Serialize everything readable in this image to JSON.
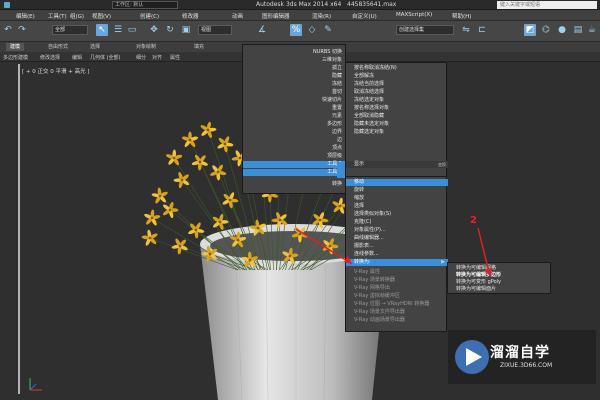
{
  "titlebar": {
    "workspace_label": "工作区: 默认",
    "app_title": "Autodesk 3ds Max  2014 x64",
    "file_name": "445835641.max",
    "search_placeholder": "键入关键字或短语"
  },
  "menubar": [
    "编辑(E)",
    "工具(T)",
    "组(G)",
    "视图(V)",
    "创建(C)",
    "修改器",
    "动画",
    "图形编辑器",
    "渲染(R)",
    "自定义(U)",
    "MAXScript(X)",
    "帮助(H)"
  ],
  "toolbar": {
    "selection_filter": "全部",
    "ref_coord": "视图",
    "named_selection": "创建选择集"
  },
  "ribbon": {
    "tabs": [
      "建模",
      "自由形式",
      "选择",
      "对象绘制",
      "填充"
    ],
    "sub_items": [
      "多边形建模",
      "修改选择",
      "编辑",
      "几何体 (全部)",
      "细分",
      "对齐",
      "属性"
    ]
  },
  "viewport": {
    "label": "[ + 0 正交 0 平滑 + 高光 ]"
  },
  "quad_left_top": {
    "items": [
      "NURBS 切换",
      "三维对象",
      "孤立",
      "隐藏",
      "冻结",
      "首切",
      "快速切片",
      "重置",
      "元素",
      "多边形",
      "边界",
      "边",
      "顶点",
      "顶层级"
    ],
    "tags": [
      "工具 1",
      "工具 2"
    ]
  },
  "quad_right_top": {
    "items": [
      "按名称取消隐藏",
      "全部取消隐藏",
      "隐藏未选定对象",
      "隐藏选定对象",
      "状态集",
      "管理状态集..."
    ],
    "header_items": [
      "按名称取消冻结(N)",
      "全部解冻",
      "冻结当前选择",
      "取消冻结选择",
      "冻结选定对象",
      "按名称选择对象",
      "全部取消隐藏",
      "隐藏未选定对象",
      "隐藏选定对象"
    ],
    "tags": [
      "显示",
      "变换"
    ],
    "footer_label": "转换"
  },
  "quad_transform": {
    "items": [
      "移动",
      "旋转",
      "缩放",
      "选择",
      "选择类似对象(S)",
      "克隆(C)",
      "对象属性(P)...",
      "曲线编辑器...",
      "摄影表...",
      "连线参数..."
    ],
    "highlighted": "移动",
    "convert_label": "转换为:",
    "vray_items": [
      "V-Ray 属性",
      "V-Ray 场景转换器",
      "V-Ray 网格导出",
      "V-Ray 虚拟帧缓冲区",
      "V-Ray 位图 → VRayHDRI 转换器",
      "V-Ray 场景文件导出器",
      "V-Ray 动画场景导出器"
    ]
  },
  "convert_submenu": {
    "items": [
      "转换为可编辑网格",
      "转换为可编辑多边形",
      "转换为可变形 gPoly",
      "转换为可编辑面片"
    ],
    "highlighted_index": 1
  },
  "annotation": {
    "step_number": "2",
    "color": "#e02020"
  },
  "watermark": {
    "brand": "溜溜自学",
    "url": "ZIXUE.3D66.COM"
  },
  "colors": {
    "accent": "#3b8fd9",
    "flower": "#e8b323",
    "pot": "#d9d9d9"
  }
}
